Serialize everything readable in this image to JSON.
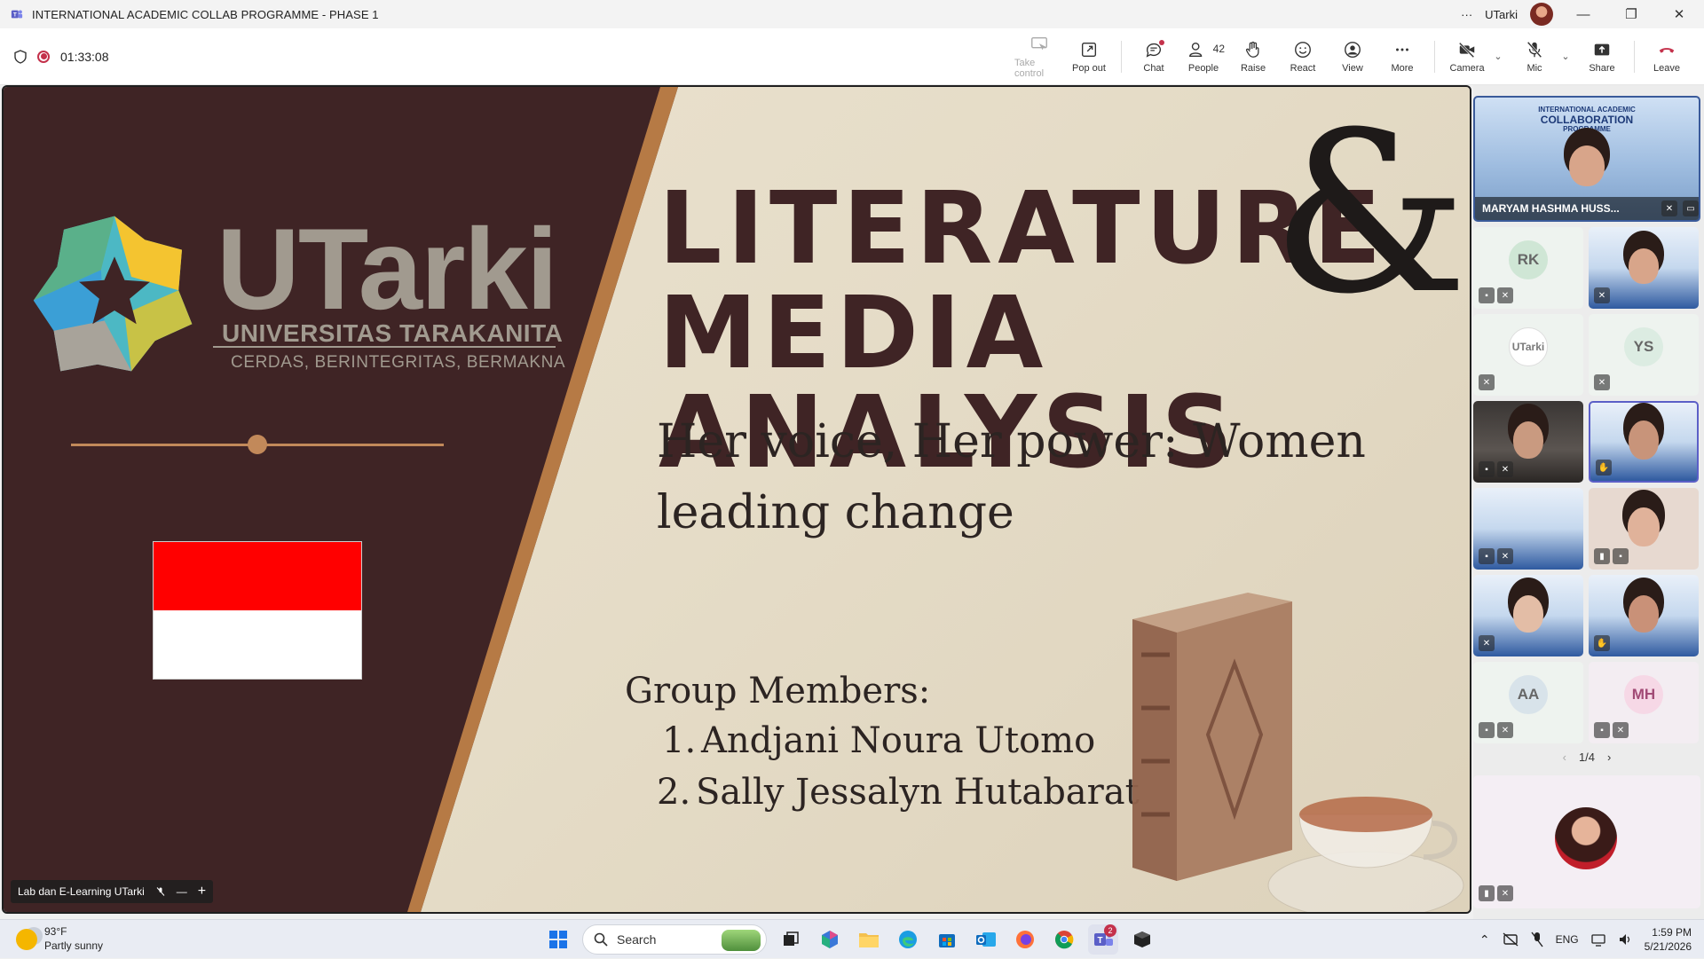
{
  "window": {
    "title": "INTERNATIONAL ACADEMIC COLLAB PROGRAMME - PHASE 1",
    "more": "···",
    "user": "UTarki",
    "minimize": "—",
    "restore": "❐",
    "close": "✕"
  },
  "meeting": {
    "timer": "01:33:08"
  },
  "toolbar": {
    "take_control": "Take control",
    "pop_out": "Pop out",
    "chat": "Chat",
    "people": "People",
    "people_count": "42",
    "raise": "Raise",
    "react": "React",
    "view": "View",
    "more": "More",
    "camera": "Camera",
    "mic": "Mic",
    "share": "Share",
    "leave": "Leave"
  },
  "slide": {
    "brand_name": "UTarki",
    "brand_sub": "UNIVERSITAS TARAKANITA",
    "brand_tag": "CERDAS, BERINTEGRITAS, BERMAKNA",
    "headline_line1": "LITERATURE",
    "headline_line2": "MEDIA ANALYSIS",
    "ampersand": "&",
    "subtitle": "Her voice, Her power: Women leading change",
    "members_heading": "Group Members:",
    "members": [
      {
        "num": "1.",
        "name": "Andjani Noura Utomo"
      },
      {
        "num": "2.",
        "name": "Sally Jessalyn Hutabarat"
      }
    ]
  },
  "presenter": {
    "name": "Lab dan E-Learning UTarki",
    "minus": "—",
    "plus": "+"
  },
  "participants": {
    "featured_name": "MARYAM HASHMA HUSS...",
    "banner_line1": "INTERNATIONAL ACADEMIC",
    "banner_line2": "COLLABORATION",
    "banner_line3": "PROGRAMME",
    "initials": [
      "RK",
      "YS",
      "AA",
      "MH"
    ],
    "utarki_logo": "UTarki",
    "pager": "1/4",
    "prev": "‹",
    "next": "›"
  },
  "taskbar": {
    "temperature": "93°F",
    "condition": "Partly sunny",
    "search_placeholder": "Search",
    "teams_badge": "2",
    "language": "ENG",
    "time": "1:59 PM",
    "date": "5/21/2026"
  }
}
